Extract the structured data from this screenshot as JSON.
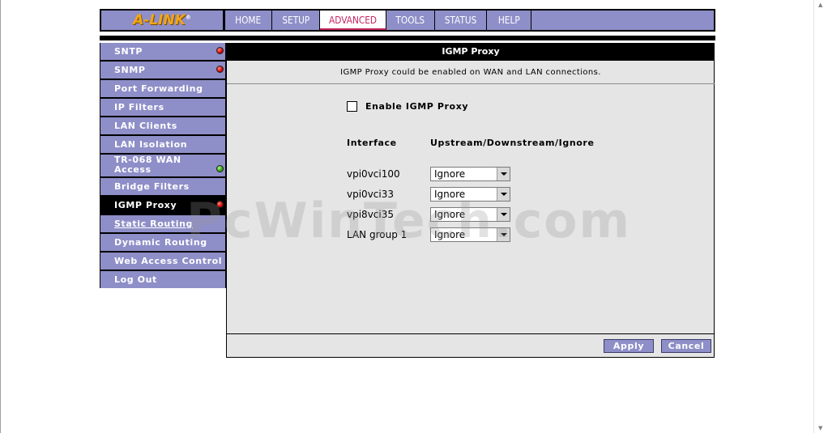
{
  "brand": {
    "logo": "A-LINK",
    "reg_mark": "®",
    "color": "#f2a616"
  },
  "colors": {
    "nav_bg": "#8e8ec8",
    "active_tab": "#c6245e",
    "panel_bg": "#e5e5e5"
  },
  "nav": {
    "tabs": [
      {
        "label": "HOME",
        "active": false
      },
      {
        "label": "SETUP",
        "active": false
      },
      {
        "label": "ADVANCED",
        "active": true
      },
      {
        "label": "TOOLS",
        "active": false
      },
      {
        "label": "STATUS",
        "active": false
      },
      {
        "label": "HELP",
        "active": false
      }
    ]
  },
  "sidebar": {
    "items": [
      {
        "label": "SNTP",
        "status": "red"
      },
      {
        "label": "SNMP",
        "status": "red"
      },
      {
        "label": "Port Forwarding"
      },
      {
        "label": "IP Filters"
      },
      {
        "label": "LAN Clients"
      },
      {
        "label": "LAN Isolation"
      },
      {
        "label": "TR-068 WAN Access",
        "status": "green"
      },
      {
        "label": "Bridge Filters"
      },
      {
        "label": "IGMP Proxy",
        "status": "red",
        "active": true
      },
      {
        "label": "Static Routing"
      },
      {
        "label": "Dynamic Routing"
      },
      {
        "label": "Web Access Control"
      },
      {
        "label": "Log Out"
      }
    ]
  },
  "main": {
    "title": "IGMP Proxy",
    "description": "IGMP Proxy could be enabled on WAN and LAN connections.",
    "enable_label": "Enable IGMP Proxy",
    "enabled": false,
    "col_interface": "Interface",
    "col_mode": "Upstream/Downstream/Ignore",
    "rows": [
      {
        "interface": "vpi0vci100",
        "mode": "Ignore"
      },
      {
        "interface": "vpi0vci33",
        "mode": "Ignore"
      },
      {
        "interface": "vpi8vci35",
        "mode": "Ignore"
      },
      {
        "interface": "LAN group 1",
        "mode": "Ignore"
      }
    ],
    "apply_label": "Apply",
    "cancel_label": "Cancel"
  },
  "watermark": "PcWinTech.com"
}
